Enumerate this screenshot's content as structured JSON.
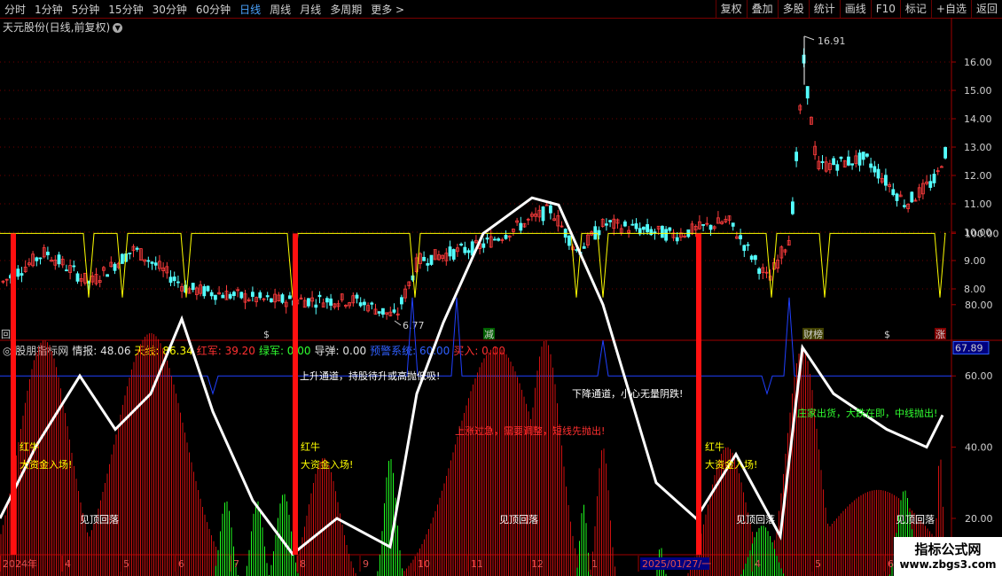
{
  "toolbar": {
    "periods": [
      "分时",
      "1分钟",
      "5分钟",
      "15分钟",
      "30分钟",
      "60分钟",
      "日线",
      "周线",
      "月线",
      "多周期",
      "更多"
    ],
    "active": "日线",
    "buttons": [
      "复权",
      "叠加",
      "多股",
      "统计",
      "画线",
      "F10",
      "标记",
      "+自选",
      "返回"
    ]
  },
  "stock": {
    "title": "天元股份(日线,前复权)"
  },
  "price_axis": {
    "labels": [
      "16.00",
      "15.00",
      "14.00",
      "13.00",
      "12.00",
      "11.00",
      "10.00",
      "9.00",
      "8.00"
    ],
    "high_label": "16.91",
    "low_label": "6.77"
  },
  "event_marks": [
    "回",
    "$",
    "减",
    "财榜",
    "$",
    "涨"
  ],
  "indicator": {
    "name": "股朋指标网",
    "fields": [
      {
        "label": "情报: 48.06",
        "color": "#e0e0e0"
      },
      {
        "label": "天线: 86.34",
        "color": "#ffff00"
      },
      {
        "label": "红军: 39.20",
        "color": "#ff3030"
      },
      {
        "label": "绿军: 0.00",
        "color": "#30ff30"
      },
      {
        "label": "导弹: 0.00",
        "color": "#e0e0e0"
      },
      {
        "label": "预警系统: 60.00",
        "color": "#3060ff"
      },
      {
        "label": "买入: 0.00",
        "color": "#ff3030"
      }
    ],
    "axis_labels": [
      "100.00",
      "80.00",
      "60.00",
      "40.00",
      "20.00"
    ],
    "current_value": "67.89"
  },
  "annotations": {
    "red_bull": "红牛",
    "big_money": "大资金入场!",
    "see_top": "见顶回落",
    "up_channel": "上升通道，持股待升或高抛低吸!",
    "down_channel": "下降通道，小心无量阴跌!",
    "rise_fast": "上涨过急，需要调整，短线先抛出!",
    "dealer_out": "庄家出货，大跌在即，中线抛出!"
  },
  "x_axis": [
    "2024年",
    "4",
    "5",
    "6",
    "7",
    "8",
    "9",
    "10",
    "11",
    "12",
    "1",
    "2025/01/27/一",
    "4",
    "5",
    "6"
  ],
  "watermark": {
    "line1": "指标公式网",
    "line2": "www.zbgs3.com"
  }
}
